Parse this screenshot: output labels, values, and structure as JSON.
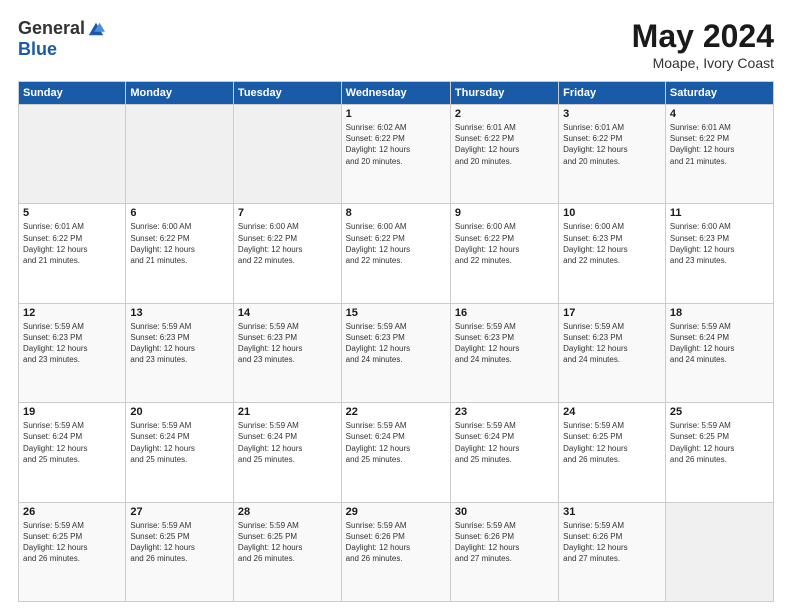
{
  "header": {
    "logo": {
      "general": "General",
      "blue": "Blue"
    },
    "title": "May 2024",
    "location": "Moape, Ivory Coast"
  },
  "days_header": [
    "Sunday",
    "Monday",
    "Tuesday",
    "Wednesday",
    "Thursday",
    "Friday",
    "Saturday"
  ],
  "weeks": [
    [
      {
        "day": "",
        "info": ""
      },
      {
        "day": "",
        "info": ""
      },
      {
        "day": "",
        "info": ""
      },
      {
        "day": "1",
        "info": "Sunrise: 6:02 AM\nSunset: 6:22 PM\nDaylight: 12 hours\nand 20 minutes."
      },
      {
        "day": "2",
        "info": "Sunrise: 6:01 AM\nSunset: 6:22 PM\nDaylight: 12 hours\nand 20 minutes."
      },
      {
        "day": "3",
        "info": "Sunrise: 6:01 AM\nSunset: 6:22 PM\nDaylight: 12 hours\nand 20 minutes."
      },
      {
        "day": "4",
        "info": "Sunrise: 6:01 AM\nSunset: 6:22 PM\nDaylight: 12 hours\nand 21 minutes."
      }
    ],
    [
      {
        "day": "5",
        "info": "Sunrise: 6:01 AM\nSunset: 6:22 PM\nDaylight: 12 hours\nand 21 minutes."
      },
      {
        "day": "6",
        "info": "Sunrise: 6:00 AM\nSunset: 6:22 PM\nDaylight: 12 hours\nand 21 minutes."
      },
      {
        "day": "7",
        "info": "Sunrise: 6:00 AM\nSunset: 6:22 PM\nDaylight: 12 hours\nand 22 minutes."
      },
      {
        "day": "8",
        "info": "Sunrise: 6:00 AM\nSunset: 6:22 PM\nDaylight: 12 hours\nand 22 minutes."
      },
      {
        "day": "9",
        "info": "Sunrise: 6:00 AM\nSunset: 6:22 PM\nDaylight: 12 hours\nand 22 minutes."
      },
      {
        "day": "10",
        "info": "Sunrise: 6:00 AM\nSunset: 6:23 PM\nDaylight: 12 hours\nand 22 minutes."
      },
      {
        "day": "11",
        "info": "Sunrise: 6:00 AM\nSunset: 6:23 PM\nDaylight: 12 hours\nand 23 minutes."
      }
    ],
    [
      {
        "day": "12",
        "info": "Sunrise: 5:59 AM\nSunset: 6:23 PM\nDaylight: 12 hours\nand 23 minutes."
      },
      {
        "day": "13",
        "info": "Sunrise: 5:59 AM\nSunset: 6:23 PM\nDaylight: 12 hours\nand 23 minutes."
      },
      {
        "day": "14",
        "info": "Sunrise: 5:59 AM\nSunset: 6:23 PM\nDaylight: 12 hours\nand 23 minutes."
      },
      {
        "day": "15",
        "info": "Sunrise: 5:59 AM\nSunset: 6:23 PM\nDaylight: 12 hours\nand 24 minutes."
      },
      {
        "day": "16",
        "info": "Sunrise: 5:59 AM\nSunset: 6:23 PM\nDaylight: 12 hours\nand 24 minutes."
      },
      {
        "day": "17",
        "info": "Sunrise: 5:59 AM\nSunset: 6:23 PM\nDaylight: 12 hours\nand 24 minutes."
      },
      {
        "day": "18",
        "info": "Sunrise: 5:59 AM\nSunset: 6:24 PM\nDaylight: 12 hours\nand 24 minutes."
      }
    ],
    [
      {
        "day": "19",
        "info": "Sunrise: 5:59 AM\nSunset: 6:24 PM\nDaylight: 12 hours\nand 25 minutes."
      },
      {
        "day": "20",
        "info": "Sunrise: 5:59 AM\nSunset: 6:24 PM\nDaylight: 12 hours\nand 25 minutes."
      },
      {
        "day": "21",
        "info": "Sunrise: 5:59 AM\nSunset: 6:24 PM\nDaylight: 12 hours\nand 25 minutes."
      },
      {
        "day": "22",
        "info": "Sunrise: 5:59 AM\nSunset: 6:24 PM\nDaylight: 12 hours\nand 25 minutes."
      },
      {
        "day": "23",
        "info": "Sunrise: 5:59 AM\nSunset: 6:24 PM\nDaylight: 12 hours\nand 25 minutes."
      },
      {
        "day": "24",
        "info": "Sunrise: 5:59 AM\nSunset: 6:25 PM\nDaylight: 12 hours\nand 26 minutes."
      },
      {
        "day": "25",
        "info": "Sunrise: 5:59 AM\nSunset: 6:25 PM\nDaylight: 12 hours\nand 26 minutes."
      }
    ],
    [
      {
        "day": "26",
        "info": "Sunrise: 5:59 AM\nSunset: 6:25 PM\nDaylight: 12 hours\nand 26 minutes."
      },
      {
        "day": "27",
        "info": "Sunrise: 5:59 AM\nSunset: 6:25 PM\nDaylight: 12 hours\nand 26 minutes."
      },
      {
        "day": "28",
        "info": "Sunrise: 5:59 AM\nSunset: 6:25 PM\nDaylight: 12 hours\nand 26 minutes."
      },
      {
        "day": "29",
        "info": "Sunrise: 5:59 AM\nSunset: 6:26 PM\nDaylight: 12 hours\nand 26 minutes."
      },
      {
        "day": "30",
        "info": "Sunrise: 5:59 AM\nSunset: 6:26 PM\nDaylight: 12 hours\nand 27 minutes."
      },
      {
        "day": "31",
        "info": "Sunrise: 5:59 AM\nSunset: 6:26 PM\nDaylight: 12 hours\nand 27 minutes."
      },
      {
        "day": "",
        "info": ""
      }
    ]
  ]
}
